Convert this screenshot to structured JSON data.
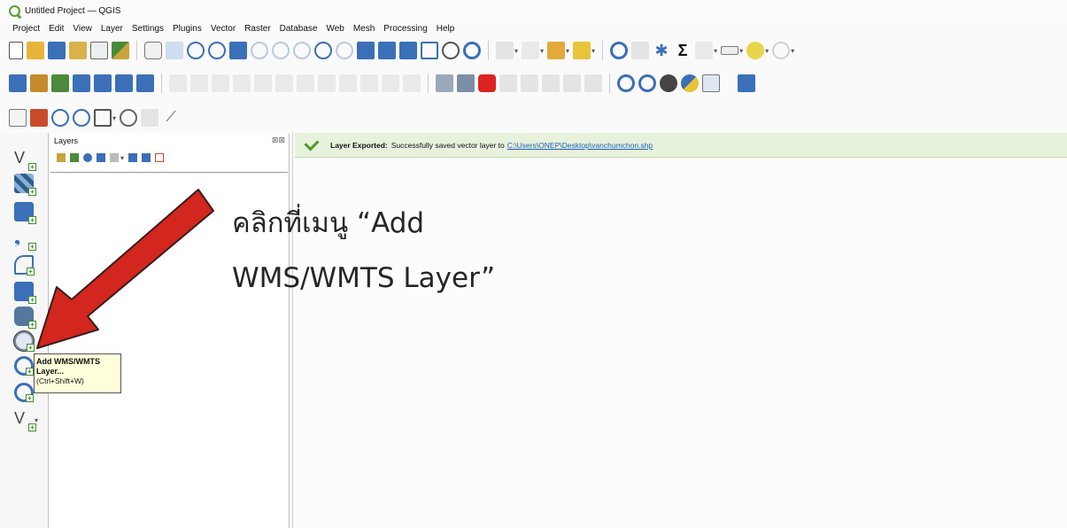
{
  "window": {
    "title": "Untitled Project — QGIS"
  },
  "menu": [
    "Project",
    "Edit",
    "View",
    "Layer",
    "Settings",
    "Plugins",
    "Vector",
    "Raster",
    "Database",
    "Web",
    "Mesh",
    "Processing",
    "Help"
  ],
  "layers_panel": {
    "title": "Layers",
    "header_buttons": "⊠⊠"
  },
  "message_bar": {
    "title": "Layer Exported:",
    "text": "Successfully saved vector layer to",
    "link": "C:\\Users\\ONEP\\Desktop\\vanchumchon.shp"
  },
  "caption": {
    "line1": "คลิกที่เมนู “Add",
    "line2": "WMS/WMTS Layer”"
  },
  "tooltip": {
    "line1": "Add WMS/WMTS",
    "line2": "Layer...",
    "shortcut": "(Ctrl+Shift+W)"
  },
  "colors": {
    "arrow": "#d2261e",
    "message_bg": "#e7f2dc",
    "check": "#4b9a26",
    "tooltip_bg": "#ffffdc"
  }
}
